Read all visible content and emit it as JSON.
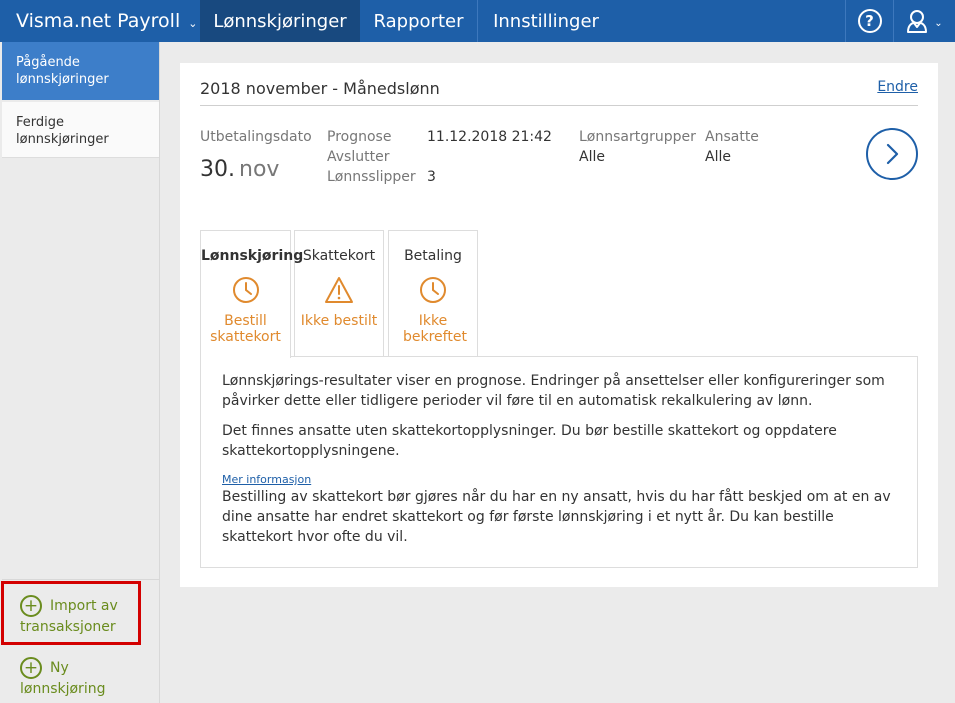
{
  "header": {
    "app_title": "Visma.net Payroll",
    "tabs": [
      {
        "label": "Lønnskjøringer",
        "active": true
      },
      {
        "label": "Rapporter"
      },
      {
        "label": "Innstillinger"
      }
    ],
    "help_label": "?",
    "icons": {
      "help": "help-circle-icon",
      "user": "user-icon",
      "chevron": "chevron-down-icon"
    }
  },
  "sidebar": {
    "items": [
      {
        "label": "Pågående lønnskjøringer",
        "active": true
      },
      {
        "label": "Ferdige lønnskjøringer"
      }
    ],
    "actions": [
      {
        "label": "Import av transaksjoner",
        "icon": "plus-circle-icon"
      },
      {
        "label": "Ny lønnskjøring",
        "icon": "plus-circle-icon"
      }
    ]
  },
  "payrun": {
    "title": "2018 november - Månedslønn",
    "edit_label": "Endre",
    "payout_label": "Utbetalingsdato",
    "payout_day": "30.",
    "payout_month": "nov",
    "forecast_label": "Prognose",
    "forecast_value": "11.12.2018 21:42",
    "closes_label": "Avslutter",
    "payslips_label": "Lønnsslipper",
    "payslips_value": "3",
    "wagetype_label": "Lønnsartgrupper",
    "wagetype_value": "Alle",
    "employees_label": "Ansatte",
    "employees_value": "Alle"
  },
  "steps": [
    {
      "title": "Lønnskjøring",
      "status": "Bestill skattekort",
      "icon": "clock-icon",
      "active": true
    },
    {
      "title": "Skattekort",
      "status": "Ikke bestilt",
      "icon": "warning-icon"
    },
    {
      "title": "Betaling",
      "status": "Ikke bekreftet",
      "icon": "clock-icon"
    }
  ],
  "messages": {
    "p1": "Lønnskjørings-resultater viser en prognose. Endringer på ansettelser eller konfigureringer som påvirker dette eller tidligere perioder vil føre til en automatisk rekalkulering av lønn.",
    "p2": "Det finnes ansatte uten skattekortopplysninger. Du bør bestille skattekort og oppdatere skattekortopplysningene.",
    "more_link": "Mer informasjon",
    "p3": "Bestilling av skattekort bør gjøres når du har en ny ansatt, hvis du har fått beskjed om at en av dine ansatte har endret skattekort og før første lønnskjøring i et nytt år. Du kan bestille skattekort hvor ofte du vil."
  },
  "colors": {
    "brand": "#1e5fa8",
    "accent_green": "#6a8c1e",
    "status_orange": "#e08a2e",
    "highlight_red": "#d30000"
  }
}
